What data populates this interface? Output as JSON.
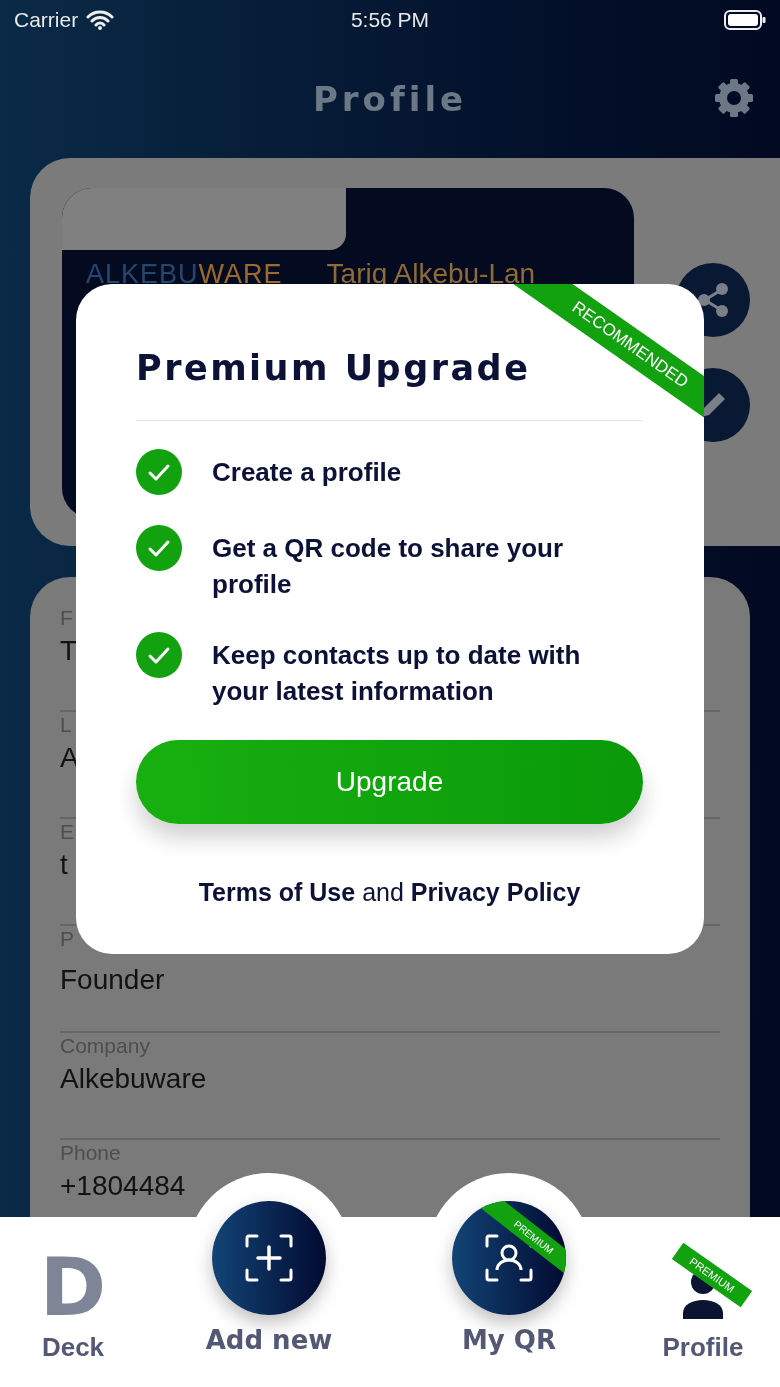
{
  "status_bar": {
    "carrier": "Carrier",
    "time": "5:56 PM"
  },
  "header": {
    "title": "Profile"
  },
  "business_card": {
    "logo_parts": [
      "ALKEBU",
      "WARE"
    ],
    "name": "Tariq Alkebu-Lan"
  },
  "fields": [
    {
      "label": "F",
      "value": "T"
    },
    {
      "label": "L",
      "value": "A"
    },
    {
      "label": "E",
      "value": "t"
    },
    {
      "label": "P",
      "value": "Founder"
    },
    {
      "label": "Company",
      "value": "Alkebuware"
    },
    {
      "label": "Phone",
      "value": "+1804484"
    }
  ],
  "modal": {
    "ribbon": "RECOMMENDED",
    "title": "Premium Upgrade",
    "features": [
      {
        "text": "Create a profile",
        "checked": true
      },
      {
        "text": "Get a QR code to share your profile",
        "checked": true
      },
      {
        "text": "Keep contacts up to date with your latest information",
        "checked": true
      }
    ],
    "button": "Upgrade",
    "legal": {
      "terms": "Terms of Use",
      "joiner": "and",
      "privacy": "Privacy Policy"
    }
  },
  "tabs": [
    {
      "label": "Deck",
      "kind": "logo",
      "glyph": "D",
      "selected": false
    },
    {
      "label": "Add new",
      "kind": "add",
      "selected": false
    },
    {
      "label": "My QR",
      "kind": "qr",
      "badge": "PREMIUM",
      "selected": false
    },
    {
      "label": "Profile",
      "kind": "person",
      "badge": "PREMIUM",
      "selected": true
    }
  ]
}
